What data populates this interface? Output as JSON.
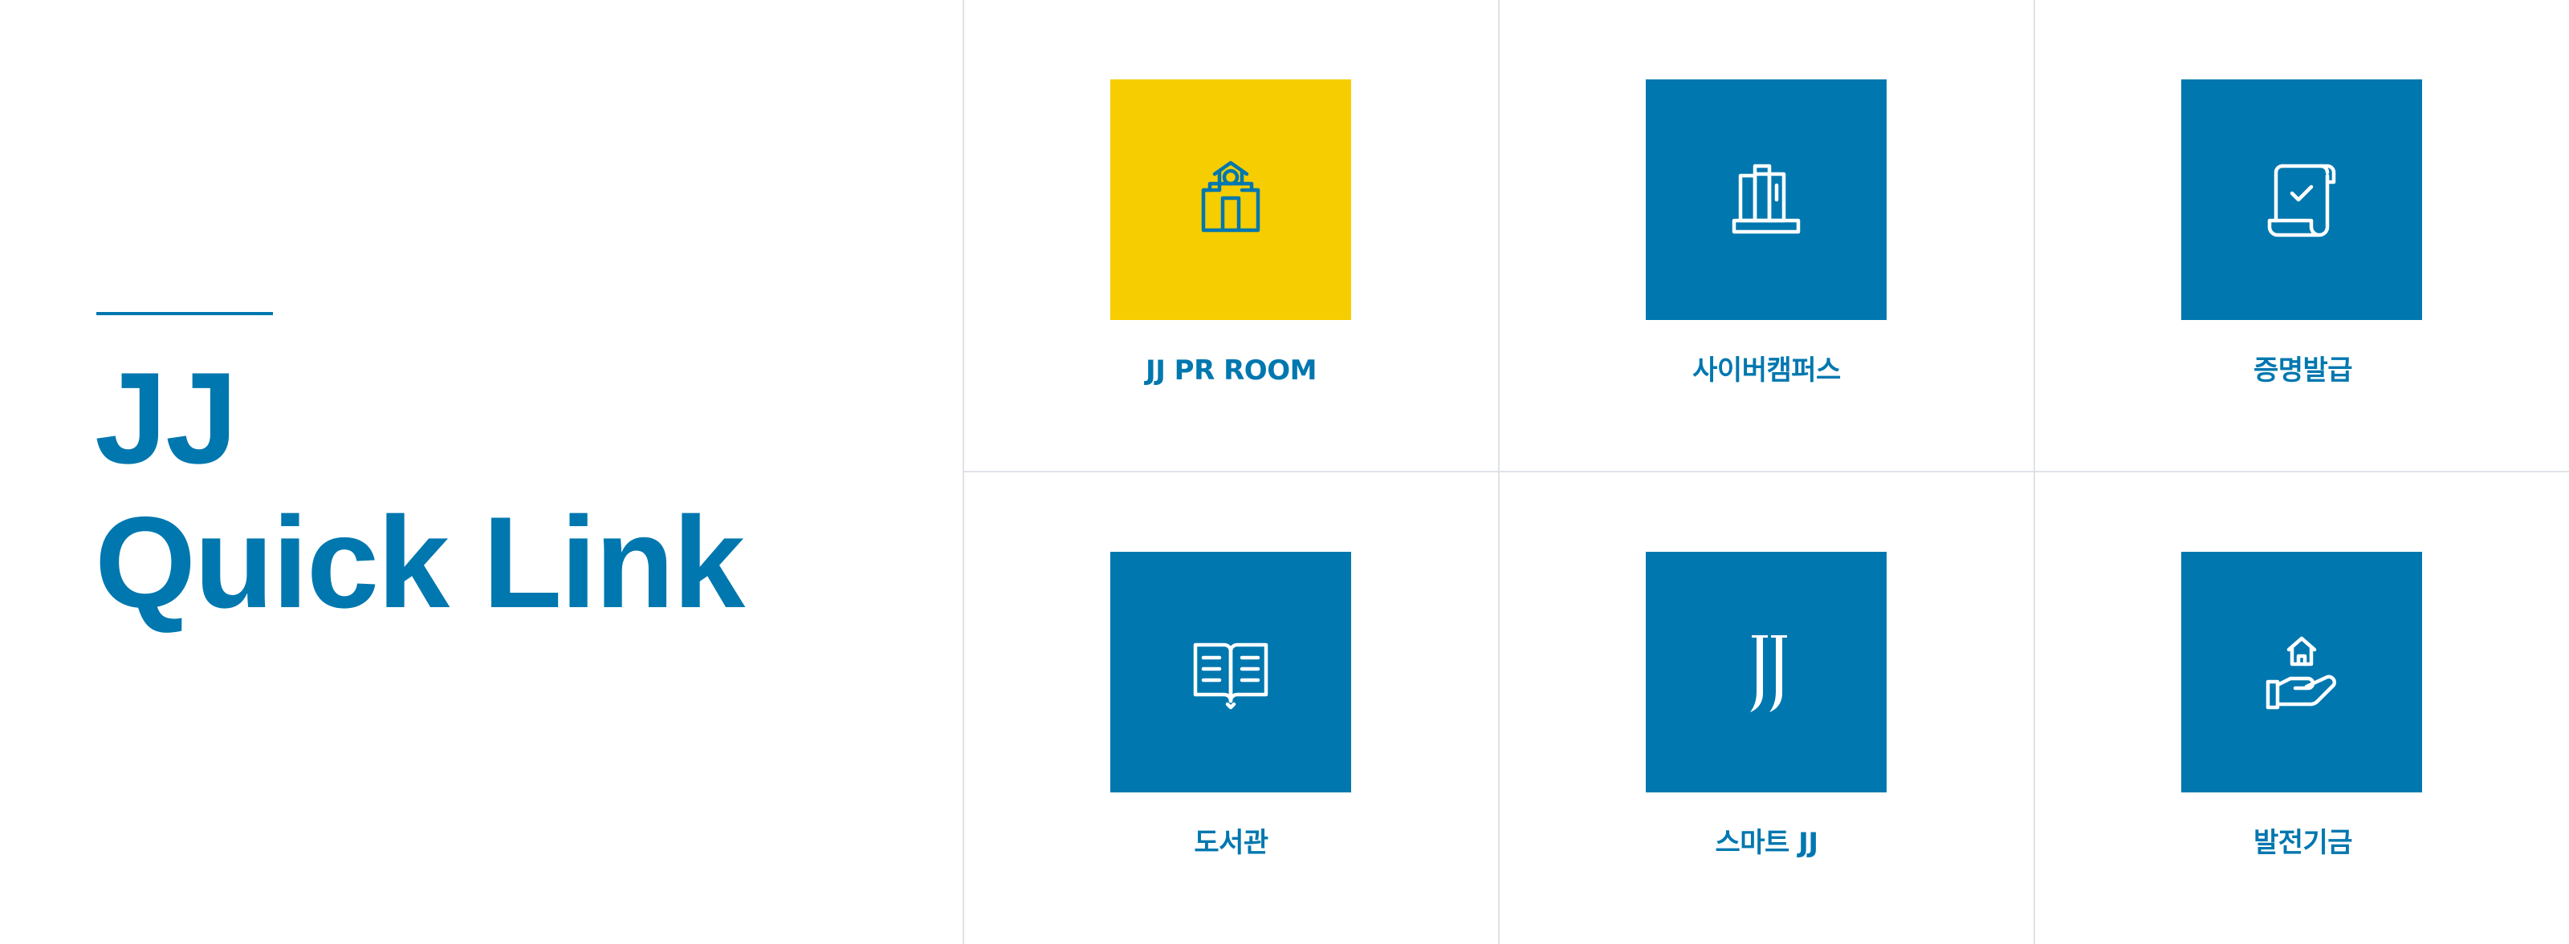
{
  "intro": {
    "title_line1": "JJ",
    "title_line2": "Quick Link"
  },
  "colors": {
    "brand_blue": "#0077af",
    "brand_yellow": "#f5cd00",
    "divider": "#dfe3e8"
  },
  "tiles": [
    {
      "label": "JJ PR ROOM",
      "icon": "school-building-icon",
      "bg": "#f5cd00"
    },
    {
      "label": "사이버캠퍼스",
      "icon": "books-icon",
      "bg": "#0077af"
    },
    {
      "label": "증명발급",
      "icon": "certificate-scroll-icon",
      "bg": "#0077af"
    },
    {
      "label": "도서관",
      "icon": "open-book-icon",
      "bg": "#0077af"
    },
    {
      "label": "스마트 JJ",
      "icon": "jj-logo-icon",
      "bg": "#0077af"
    },
    {
      "label": "발전기금",
      "icon": "hand-house-icon",
      "bg": "#0077af"
    }
  ]
}
